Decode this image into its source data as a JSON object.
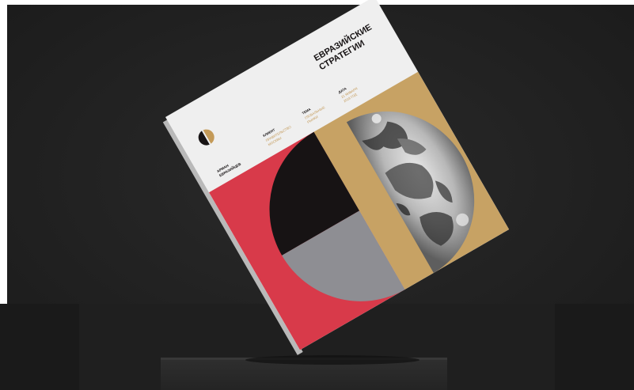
{
  "scene": {
    "background_color": "#1f1f1f",
    "backdrop_color": "#232323",
    "floor_color": "#1c1c1c",
    "pedestal_color": "#2b2b2b"
  },
  "book": {
    "title_line1": "ЕВРАЗИЙСКИЕ",
    "title_line2": "СТРАТЕГИИ",
    "author_line1": "АРМАН",
    "author_line2": "ЕВРАЗИЙЦЕВ",
    "meta_col1_heading": "КЛИЕНТ",
    "meta_col1_line1": "ПРАВИТЕЛЬСТВО",
    "meta_col1_line2": "МОСКВЫ",
    "meta_col2_heading": "ТЕМА",
    "meta_col2_line1": "ГЛОБАЛЬНЫЕ",
    "meta_col2_line2": "РЫНКИ",
    "meta_col3_heading": "ДАТА",
    "meta_col3_line1": "21 ЯНВАРЯ",
    "meta_col3_line2": "2018 ГОД",
    "colors": {
      "white": "#efefef",
      "red": "#d83a4a",
      "gold": "#c7a264",
      "black": "#171314",
      "gray": "#8e8e93",
      "logo_gold": "#c49a58"
    },
    "globe_image": "black-and-white-earth-photo"
  }
}
